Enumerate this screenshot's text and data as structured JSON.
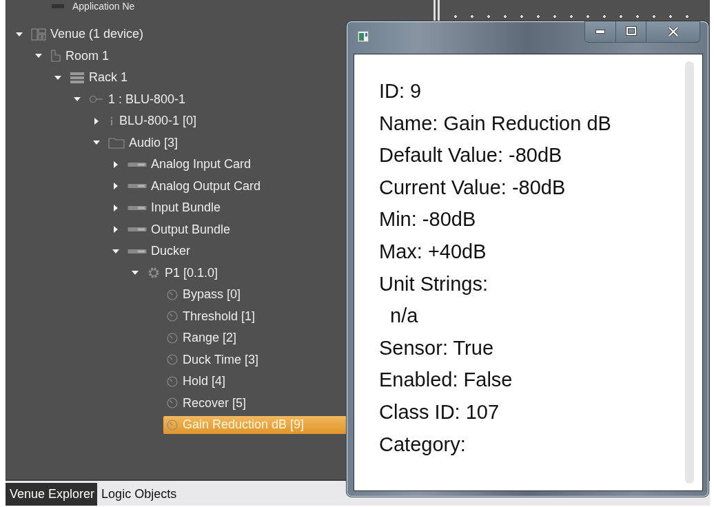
{
  "tree_header": {
    "label": "Application Ne"
  },
  "tree": [
    {
      "label": "Venue (1 device)",
      "kind": "venue",
      "expanded": true,
      "selected": false,
      "children": [
        {
          "label": "Room 1",
          "kind": "room",
          "expanded": true,
          "selected": false,
          "children": [
            {
              "label": "Rack 1",
              "kind": "rack",
              "expanded": true,
              "selected": false,
              "children": [
                {
                  "label": "1 : BLU-800-1",
                  "kind": "device",
                  "expanded": true,
                  "selected": false,
                  "children": [
                    {
                      "label": "BLU-800-1 [0]",
                      "kind": "info",
                      "expanded": false,
                      "selected": false
                    },
                    {
                      "label": "Audio [3]",
                      "kind": "folder",
                      "expanded": true,
                      "selected": false,
                      "children": [
                        {
                          "label": "Analog Input Card",
                          "kind": "module",
                          "expanded": false,
                          "selected": false
                        },
                        {
                          "label": "Analog Output Card",
                          "kind": "module",
                          "expanded": false,
                          "selected": false
                        },
                        {
                          "label": "Input Bundle",
                          "kind": "module",
                          "expanded": false,
                          "selected": false
                        },
                        {
                          "label": "Output Bundle",
                          "kind": "module",
                          "expanded": false,
                          "selected": false
                        },
                        {
                          "label": "Ducker",
                          "kind": "module",
                          "expanded": true,
                          "selected": false,
                          "children": [
                            {
                              "label": "P1 [0.1.0]",
                              "kind": "gear",
                              "expanded": true,
                              "selected": false,
                              "children": [
                                {
                                  "label": "Bypass [0]",
                                  "kind": "parameter",
                                  "selected": false
                                },
                                {
                                  "label": "Threshold [1]",
                                  "kind": "parameter",
                                  "selected": false
                                },
                                {
                                  "label": "Range [2]",
                                  "kind": "parameter",
                                  "selected": false
                                },
                                {
                                  "label": "Duck Time [3]",
                                  "kind": "parameter",
                                  "selected": false
                                },
                                {
                                  "label": "Hold [4]",
                                  "kind": "parameter",
                                  "selected": false
                                },
                                {
                                  "label": "Recover [5]",
                                  "kind": "parameter",
                                  "selected": false
                                },
                                {
                                  "label": "Gain Reduction dB [9]",
                                  "kind": "parameter",
                                  "selected": true
                                }
                              ]
                            }
                          ]
                        }
                      ]
                    }
                  ]
                }
              ]
            }
          ]
        }
      ]
    }
  ],
  "bottom_tabs": [
    {
      "label": "Venue Explorer",
      "selected": true
    },
    {
      "label": "Logic Objects",
      "selected": false
    }
  ],
  "popup": {
    "window_controls": [
      {
        "kind": "minimize"
      },
      {
        "kind": "maximize"
      },
      {
        "kind": "close"
      }
    ],
    "lines": [
      "ID: 9",
      "Name: Gain Reduction dB",
      "Default Value: -80dB",
      "Current Value: -80dB",
      "Min: -80dB",
      "Max: +40dB",
      "Unit Strings:",
      "  n/a",
      "Sensor: True",
      "Enabled: False",
      "Class ID: 107",
      "Category:"
    ]
  }
}
